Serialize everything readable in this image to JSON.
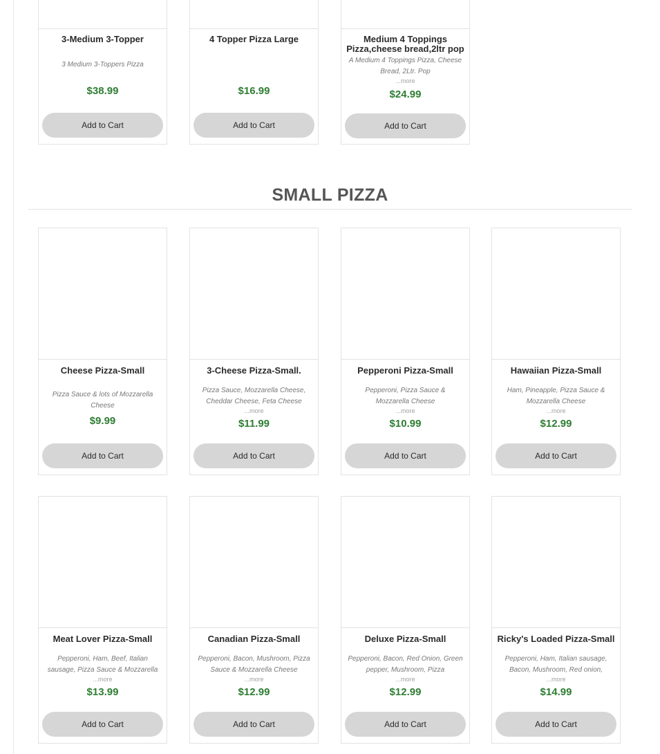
{
  "top_products": [
    {
      "name": "3-Medium 3-Topper",
      "description": "3 Medium 3-Toppers Pizza",
      "more": "",
      "price": "$38.99",
      "button": "Add to Cart"
    },
    {
      "name": "4 Topper Pizza Large",
      "description": "",
      "more": "",
      "price": "$16.99",
      "button": "Add to Cart"
    },
    {
      "name": "Medium 4 Toppings Pizza,cheese bread,2ltr pop",
      "description": "A Medium 4 Toppings Pizza, Cheese Bread, 2Ltr. Pop",
      "more": "...more",
      "price": "$24.99",
      "button": "Add to Cart"
    }
  ],
  "section": {
    "title": "SMALL PIZZA"
  },
  "small_row1": [
    {
      "name": "Cheese Pizza-Small",
      "description": "Pizza Sauce & lots of Mozzarella Cheese",
      "more": "",
      "price": "$9.99",
      "button": "Add to Cart"
    },
    {
      "name": "3-Cheese Pizza-Small.",
      "description": "Pizza Sauce, Mozzarella Cheese, Cheddar Cheese, Feta Cheese",
      "more": "...more",
      "price": "$11.99",
      "button": "Add to Cart"
    },
    {
      "name": "Pepperoni Pizza-Small",
      "description": "Pepperoni, Pizza Sauce & Mozzarella Cheese",
      "more": "...more",
      "price": "$10.99",
      "button": "Add to Cart"
    },
    {
      "name": "Hawaiian Pizza-Small",
      "description": "Ham, Pineapple, Pizza Sauce & Mozzarella Cheese",
      "more": "...more",
      "price": "$12.99",
      "button": "Add to Cart"
    }
  ],
  "small_row2": [
    {
      "name": "Meat Lover Pizza-Small",
      "description": "Pepperoni, Ham, Beef, Italian sausage, Pizza Sauce & Mozzarella",
      "more": "...more",
      "price": "$13.99",
      "button": "Add to Cart"
    },
    {
      "name": "Canadian Pizza-Small",
      "description": "Pepperoni, Bacon, Mushroom, Pizza Sauce & Mozzarella Cheese",
      "more": "...more",
      "price": "$12.99",
      "button": "Add to Cart"
    },
    {
      "name": "Deluxe Pizza-Small",
      "description": "Pepperoni, Bacon, Red Onion, Green pepper, Mushroom, Pizza",
      "more": "...more",
      "price": "$12.99",
      "button": "Add to Cart"
    },
    {
      "name": "Ricky's Loaded Pizza-Small",
      "description": "Pepperoni, Ham, Italian sausage, Bacon, Mushroom, Red onion,",
      "more": "...more",
      "price": "$14.99",
      "button": "Add to Cart"
    }
  ],
  "colors": {
    "price": "#2e7d32",
    "button_bg": "#d6d6d6",
    "border": "#e2e2e2",
    "section_title": "#555555"
  }
}
